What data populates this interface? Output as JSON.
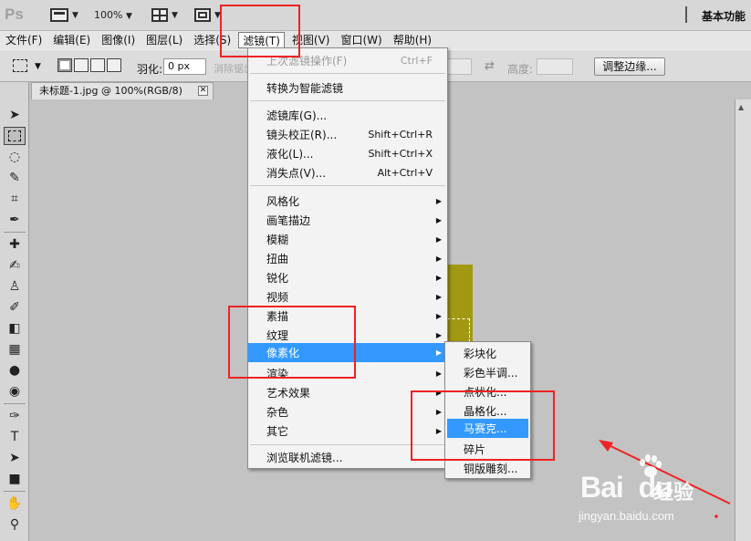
{
  "appbar": {
    "logo": "Ps",
    "zoom": "100%",
    "workspace": "基本功能"
  },
  "menubar": {
    "items": [
      {
        "label": "文件(F)"
      },
      {
        "label": "编辑(E)"
      },
      {
        "label": "图像(I)"
      },
      {
        "label": "图层(L)"
      },
      {
        "label": "选择(S)"
      },
      {
        "label": "滤镜(T)",
        "active": true
      },
      {
        "label": "视图(V)"
      },
      {
        "label": "窗口(W)"
      },
      {
        "label": "帮助(H)"
      }
    ]
  },
  "options": {
    "feather_label": "羽化:",
    "feather_value": "0 px",
    "antialias_label": "消除锯齿",
    "height_label": "高度:",
    "refine_edge": "调整边缘..."
  },
  "document": {
    "tab_title": "未标题-1.jpg @ 100%(RGB/8)",
    "image_color": "#a29913"
  },
  "filter_menu": {
    "last_filter": {
      "label": "上次滤镜操作(F)",
      "shortcut": "Ctrl+F"
    },
    "smart": "转换为智能滤镜",
    "gallery": "滤镜库(G)...",
    "lens": {
      "label": "镜头校正(R)...",
      "shortcut": "Shift+Ctrl+R"
    },
    "liquify": {
      "label": "液化(L)...",
      "shortcut": "Shift+Ctrl+X"
    },
    "vanishing": {
      "label": "消失点(V)...",
      "shortcut": "Alt+Ctrl+V"
    },
    "groups": [
      "风格化",
      "画笔描边",
      "模糊",
      "扭曲",
      "锐化",
      "视频",
      "素描",
      "纹理",
      "像素化",
      "渲染",
      "艺术效果",
      "杂色",
      "其它"
    ],
    "highlighted_group": "像素化",
    "browse_online": "浏览联机滤镜..."
  },
  "pixelate_submenu": {
    "items": [
      "彩块化",
      "彩色半调...",
      "点状化...",
      "晶格化...",
      "马赛克...",
      "碎片",
      "铜版雕刻..."
    ],
    "highlighted": "马赛克..."
  },
  "annotations": {
    "highlight_color": "#e22222"
  },
  "watermark": {
    "brand": "Bai",
    "brand2": "du",
    "jingyan": "经验",
    "url": "jingyan.baidu.com"
  }
}
